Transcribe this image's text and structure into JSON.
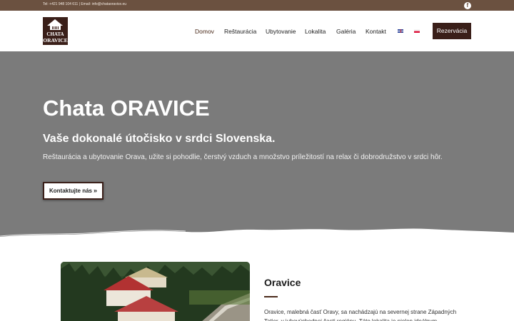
{
  "topbar": {
    "contact": "Tel: +421 948 104 611 | Email: info@chataoravice.eu",
    "social_icon": "facebook-icon"
  },
  "header": {
    "logo_line1": "CHATA",
    "logo_line2": "ORAVICE",
    "nav": [
      "Domov",
      "Reštaurácia",
      "Ubytovanie",
      "Lokalita",
      "Galéria",
      "Kontakt"
    ],
    "active_nav": "Domov",
    "languages": [
      "uk-flag-icon",
      "pl-flag-icon"
    ],
    "cta_label": "Rezervácia"
  },
  "hero": {
    "title": "Chata ORAVICE",
    "subtitle": "Vaše dokonalé útočisko v srdci Slovenska.",
    "description": "Reštaurácia a ubytovanie Orava, užite si pohodlie, čerstvý vzduch a množstvo príležitostí na relax či dobrodružstvo v srdci hôr.",
    "button_label": "Kontaktujte nás",
    "button_icon": "»"
  },
  "intro": {
    "title": "Oravice",
    "text": "Oravice, malebná časť Oravy, sa nachádzajú na severnej strane Západných Tatier, v juhovýchodnej časti regiónu. Táto lokalita je nielen ideálnym"
  },
  "colors": {
    "brand_brown": "#3a1f19",
    "topbar": "#6b5140",
    "hero_gray": "#7b7b7b"
  }
}
